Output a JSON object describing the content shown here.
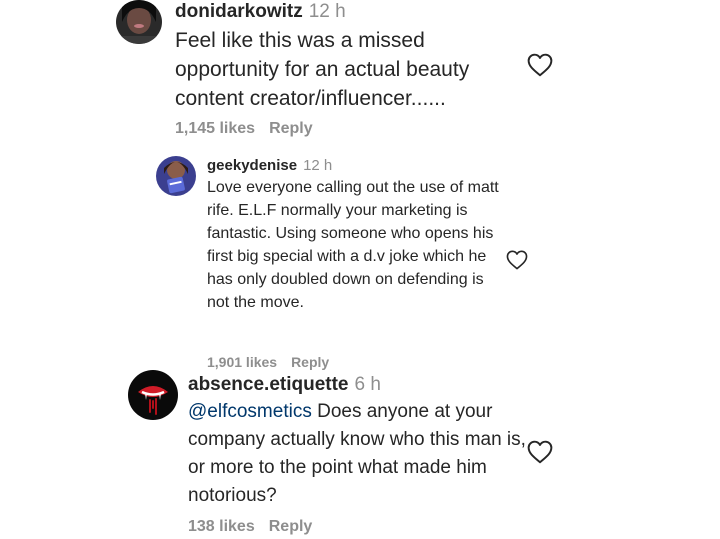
{
  "comments": [
    {
      "username": "donidarkowitz",
      "time": "12 h",
      "text": "Feel like this was a missed opportunity for an actual beauty content creator/influencer......",
      "likes": "1,145 likes",
      "reply_label": "Reply",
      "avatar_icon": "profile-photo"
    },
    {
      "username": "geekydenise",
      "time": "12 h",
      "text": "Love everyone calling out the use of matt rife. E.L.F normally your marketing is fantastic. Using someone who opens his first big special with a d.v joke which he has only doubled down on defending is not the move.",
      "likes": "1,901 likes",
      "reply_label": "Reply",
      "avatar_icon": "profile-photo"
    },
    {
      "username": "absence.etiquette",
      "time": "6 h",
      "mention": "@elfcosmetics",
      "text": "Does anyone at your company actually know who this man is, or more to the point what made him notorious?",
      "likes": "138 likes",
      "reply_label": "Reply",
      "avatar_icon": "profile-photo"
    }
  ],
  "icons": {
    "like": "heart-outline-icon"
  },
  "colors": {
    "text": "#262626",
    "secondary": "#8e8e8e",
    "mention": "#00376b"
  }
}
